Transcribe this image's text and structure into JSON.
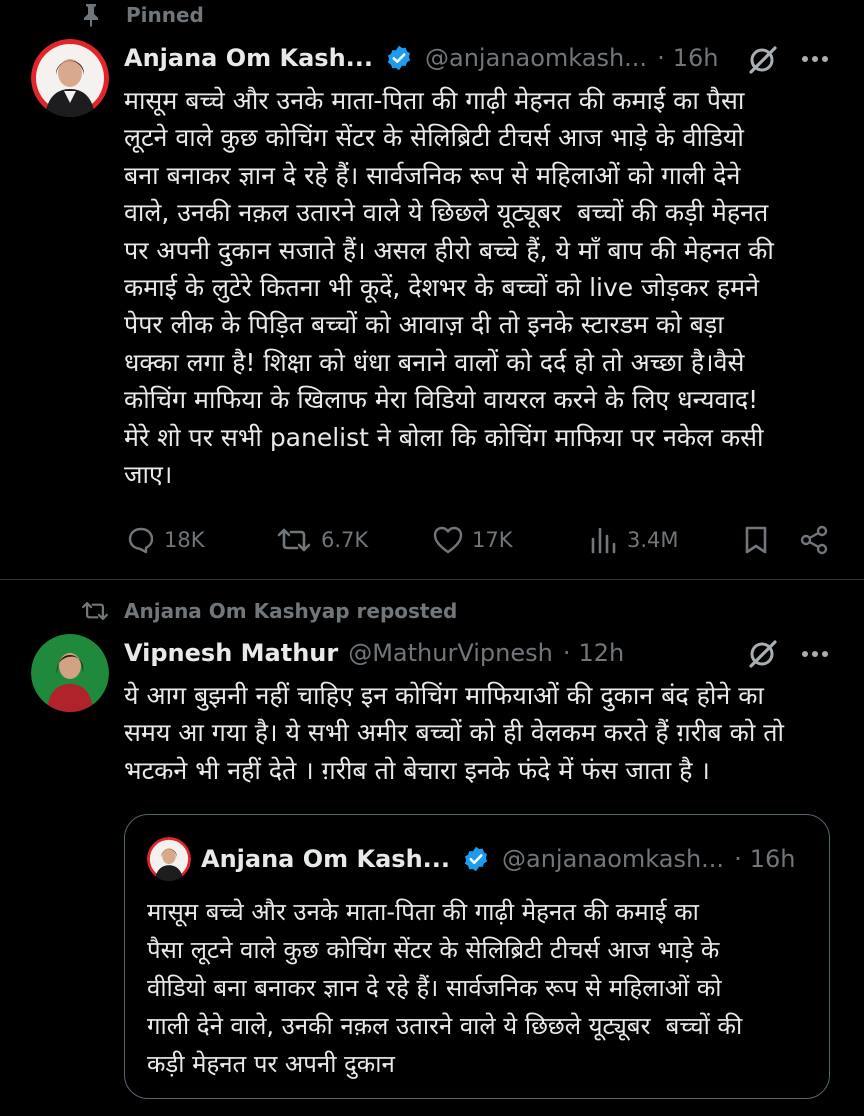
{
  "pinned": {
    "label": "Pinned"
  },
  "tweet1": {
    "name": "Anjana Om Kash...",
    "handle": "@anjanaomkash...",
    "dot": "·",
    "time": "16h",
    "lines": [
      "मासूम बच्चे और उनके माता-पिता की गाढ़ी मेहनत की कमाई का पैसा",
      "लूटने वाले कुछ कोचिंग सेंटर के सेलिब्रिटी टीचर्स आज भाड़े के वीडियो",
      "बना बनाकर ज्ञान दे रहे हैं। सार्वजनिक रूप से महिलाओं को गाली देने",
      "वाले, उनकी नक़ल उतारने वाले ये छिछले यूट्यूबर  बच्चों की कड़ी मेहनत",
      "पर अपनी दुकान सजाते हैं। असल हीरो बच्चे हैं, ये माँ बाप की मेहनत की",
      "कमाई के लुटेरे कितना भी कूदें, देशभर के बच्चों को live जोड़कर हमने",
      "पेपर लीक के पिड़ित बच्चों को आवाज़ दी तो इनके स्टारडम को बड़ा",
      "धक्का लगा है! शिक्षा को धंधा बनाने वालों को दर्द हो तो अच्छा है।वैसे",
      "कोचिंग माफिया के खिलाफ मेरा विडियो वायरल करने के लिए धन्यवाद!",
      "मेरे शो पर सभी panelist ने बोला कि कोचिंग माफिया पर नकेल कसी",
      "जाए।"
    ],
    "actions": {
      "replies": "18K",
      "reposts": "6.7K",
      "likes": "17K",
      "views": "3.4M"
    }
  },
  "tweet2": {
    "repost_label": "Anjana Om Kashyap reposted",
    "name": "Vipnesh Mathur",
    "handle": "@MathurVipnesh",
    "dot": "·",
    "time": "12h",
    "lines": [
      "ये आग बुझनी नहीं चाहिए इन कोचिंग माफियाओं की दुकान बंद होने का",
      "समय आ गया है। ये सभी अमीर बच्चों को ही वेलकम करते हैं ग़रीब को तो",
      "भटकने भी नहीं देते । ग़रीब तो बेचारा इनके फंदे में फंस जाता है ।"
    ],
    "quote": {
      "name": "Anjana Om Kash...",
      "handle": "@anjanaomkash...",
      "dot": "·",
      "time": "16h",
      "lines": [
        "मासूम बच्चे और उनके माता-पिता की गाढ़ी मेहनत की कमाई का",
        "पैसा लूटने वाले कुछ कोचिंग सेंटर के सेलिब्रिटी टीचर्स आज भाड़े के",
        "वीडियो बना बनाकर ज्ञान दे रहे हैं। सार्वजनिक रूप से महिलाओं को",
        "गाली देने वाले, उनकी नक़ल उतारने वाले ये छिछले यूट्यूबर  बच्चों की",
        "कड़ी मेहनत पर अपनी दुकान"
      ]
    }
  },
  "colors": {
    "background": "#000000",
    "text": "#e7e9ea",
    "muted": "#71767b",
    "verified": "#1d9bf0",
    "divider": "#2f3336",
    "avatar1_ring": "#e0262b",
    "avatar2_bg": "#1f8a3c"
  },
  "icons": [
    "pin-icon",
    "verified-badge-icon",
    "grok-icon",
    "more-icon",
    "reply-icon",
    "repost-icon",
    "like-icon",
    "views-icon",
    "bookmark-icon",
    "share-icon"
  ]
}
